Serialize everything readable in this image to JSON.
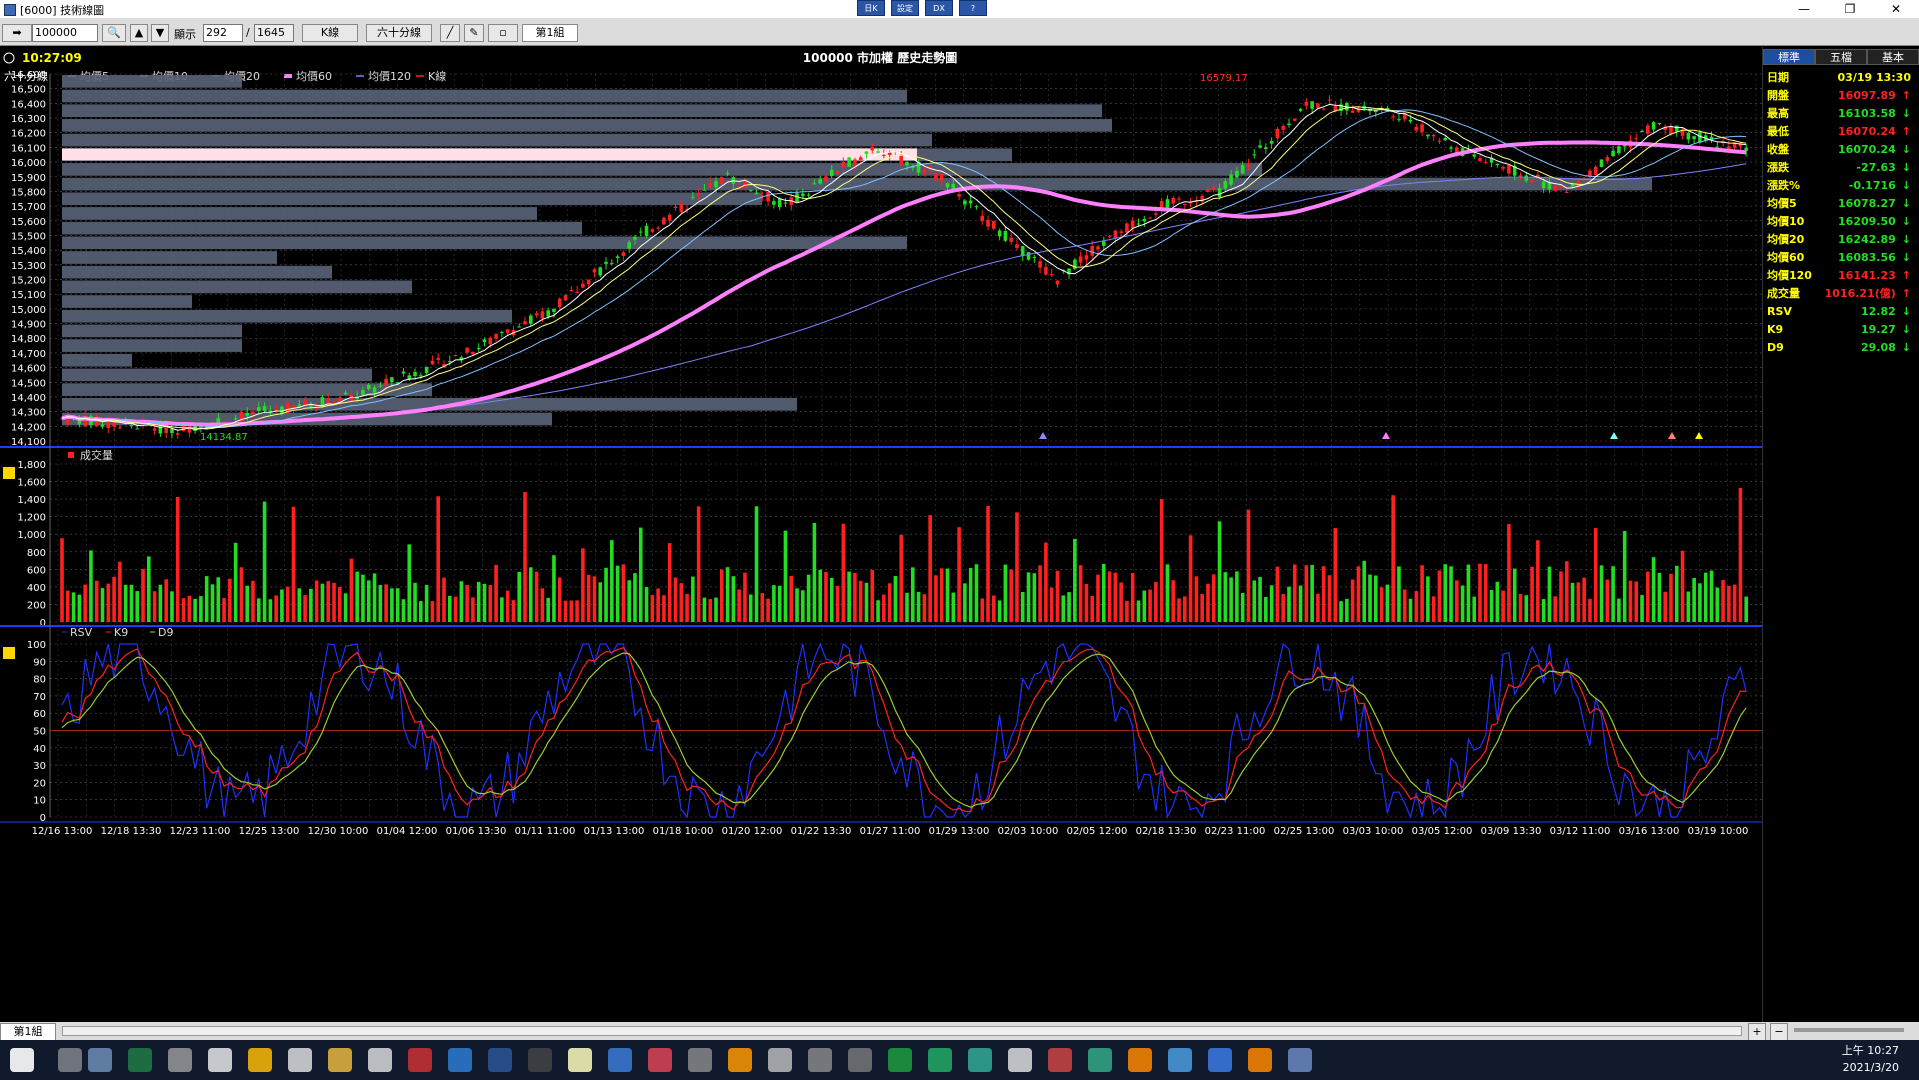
{
  "window": {
    "title": "[6000] 技術線圖",
    "ctrl_buttons": [
      "日K",
      "設定",
      "DX",
      "?"
    ]
  },
  "toolbar": {
    "symbol": "100000",
    "display_label": "顯示",
    "display_count": "292",
    "total_count": "1645",
    "period_select": "K線",
    "interval_select": "六十分線",
    "group_select": "第1組"
  },
  "header": {
    "time": "10:27:09",
    "chart_title": "100000 市加權  歷史走勢圖",
    "interval_label": "六十分線"
  },
  "legend": {
    "items": [
      {
        "label": "均價5",
        "color": "#ffffff"
      },
      {
        "label": "均價10",
        "color": "#ffff80"
      },
      {
        "label": "均價20",
        "color": "#80c0ff"
      },
      {
        "label": "均價60",
        "color": "#ff80ff"
      },
      {
        "label": "均價120",
        "color": "#8080ff"
      },
      {
        "label": "K線",
        "color": "#ff2020"
      }
    ],
    "volume_label": "成交量",
    "kd_items": [
      "RSV",
      "K9",
      "D9"
    ]
  },
  "annotations": {
    "high_label": "16579.17",
    "low_label": "14134.87"
  },
  "chart_data": {
    "type": "candlestick",
    "price_axis": {
      "min": 14100,
      "max": 16600,
      "ticks": [
        "16,600",
        "16,500",
        "16,400",
        "16,300",
        "16,200",
        "16,100",
        "16,000",
        "15,900",
        "15,800",
        "15,700",
        "15,600",
        "15,500",
        "15,400",
        "15,300",
        "15,200",
        "15,100",
        "15,000",
        "14,900",
        "14,800",
        "14,700",
        "14,600",
        "14,500",
        "14,400",
        "14,300",
        "14,200",
        "14,100"
      ]
    },
    "volume_axis": {
      "min": 0,
      "max": 1900,
      "ticks": [
        "1,800",
        "1,600",
        "1,400",
        "1,200",
        "1,000",
        "800",
        "600",
        "400",
        "200",
        "0"
      ]
    },
    "kd_axis": {
      "min": 0,
      "max": 100,
      "ticks": [
        "100",
        "90",
        "80",
        "70",
        "60",
        "50",
        "40",
        "30",
        "20",
        "10",
        "0"
      ]
    },
    "x_labels": [
      "12/16 13:00",
      "12/18 13:30",
      "12/23 11:00",
      "12/25 13:00",
      "12/30 10:00",
      "01/04 12:00",
      "01/06 13:30",
      "01/11 11:00",
      "01/13 13:00",
      "01/18 10:00",
      "01/20 12:00",
      "01/22 13:30",
      "01/27 11:00",
      "01/29 13:00",
      "02/03 10:00",
      "02/05 12:00",
      "02/18 13:30",
      "02/23 11:00",
      "02/25 13:00",
      "03/03 10:00",
      "03/05 12:00",
      "03/09 13:30",
      "03/12 11:00",
      "03/16 13:00",
      "03/19 10:00"
    ]
  },
  "right_panel": {
    "tabs": [
      "標準",
      "五檔",
      "基本"
    ],
    "rows": [
      {
        "label": "日期",
        "value": "03/19 13:30",
        "dir": "none"
      },
      {
        "label": "開盤",
        "value": "16097.89",
        "dir": "up"
      },
      {
        "label": "最高",
        "value": "16103.58",
        "dir": "dn"
      },
      {
        "label": "最低",
        "value": "16070.24",
        "dir": "up"
      },
      {
        "label": "收盤",
        "value": "16070.24",
        "dir": "dn"
      },
      {
        "label": "漲跌",
        "value": "-27.63",
        "dir": "dn"
      },
      {
        "label": "漲跌%",
        "value": "-0.1716",
        "dir": "dn"
      },
      {
        "label": "均價5",
        "value": "16078.27",
        "dir": "dn"
      },
      {
        "label": "均價10",
        "value": "16209.50",
        "dir": "dn"
      },
      {
        "label": "均價20",
        "value": "16242.89",
        "dir": "dn"
      },
      {
        "label": "均價60",
        "value": "16083.56",
        "dir": "dn"
      },
      {
        "label": "均價120",
        "value": "16141.23",
        "dir": "up"
      },
      {
        "label": "成交量",
        "value": "1016.21(億)",
        "dir": "up"
      },
      {
        "label": "RSV",
        "value": "12.82",
        "dir": "dn"
      },
      {
        "label": "K9",
        "value": "19.27",
        "dir": "dn"
      },
      {
        "label": "D9",
        "value": "29.08",
        "dir": "dn"
      }
    ],
    "settings_label": "設定"
  },
  "bottombar": {
    "group": "第1組"
  },
  "clock": {
    "time": "上午 10:27",
    "date": "2021/3/20"
  }
}
